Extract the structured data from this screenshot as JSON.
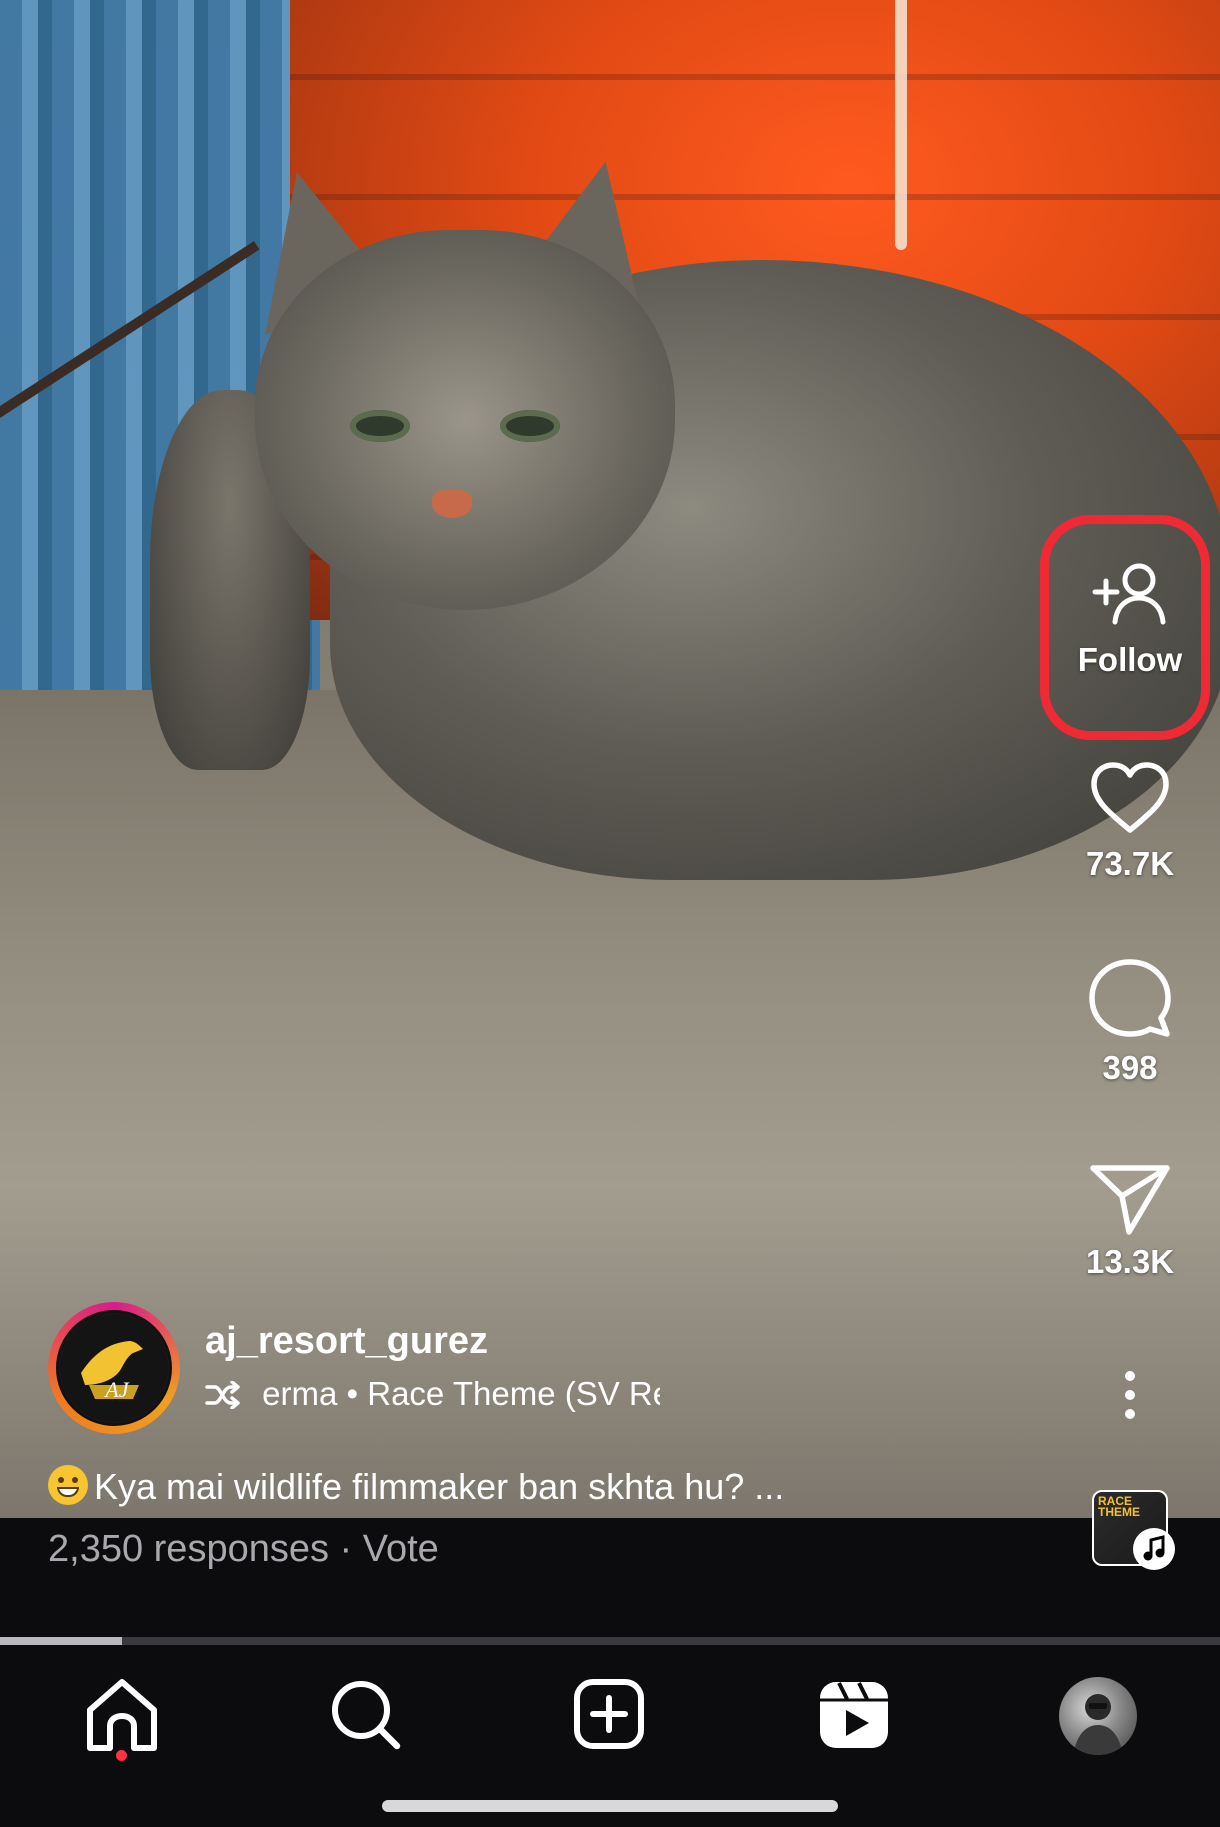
{
  "reel": {
    "author": {
      "username": "aj_resort_gurez",
      "avatar_text": "AJ"
    },
    "audio": {
      "icon": "shuffle-icon",
      "text": "erma • Race Theme (SV Re"
    },
    "caption": {
      "emoji": "grinning-face",
      "text": "Kya mai wildlife filmmaker ban skhta hu? ..."
    },
    "poll": {
      "text": "2,350 responses · Vote"
    },
    "music_thumb": {
      "text": "RACE THEME"
    },
    "progress": 0.1
  },
  "actions": {
    "follow": {
      "label": "Follow",
      "icon": "add-user-icon"
    },
    "like": {
      "count": "73.7K",
      "icon": "heart-icon"
    },
    "comment": {
      "count": "398",
      "icon": "comment-icon"
    },
    "share": {
      "count": "13.3K",
      "icon": "send-icon"
    },
    "more": {
      "icon": "more-vertical-icon"
    }
  },
  "nav": {
    "items": [
      "home-icon",
      "search-icon",
      "create-icon",
      "reels-icon",
      "profile-avatar"
    ]
  },
  "colors": {
    "highlight": "#ef2a35",
    "notification_dot": "#ff3040",
    "background": "#0c0c0f"
  }
}
